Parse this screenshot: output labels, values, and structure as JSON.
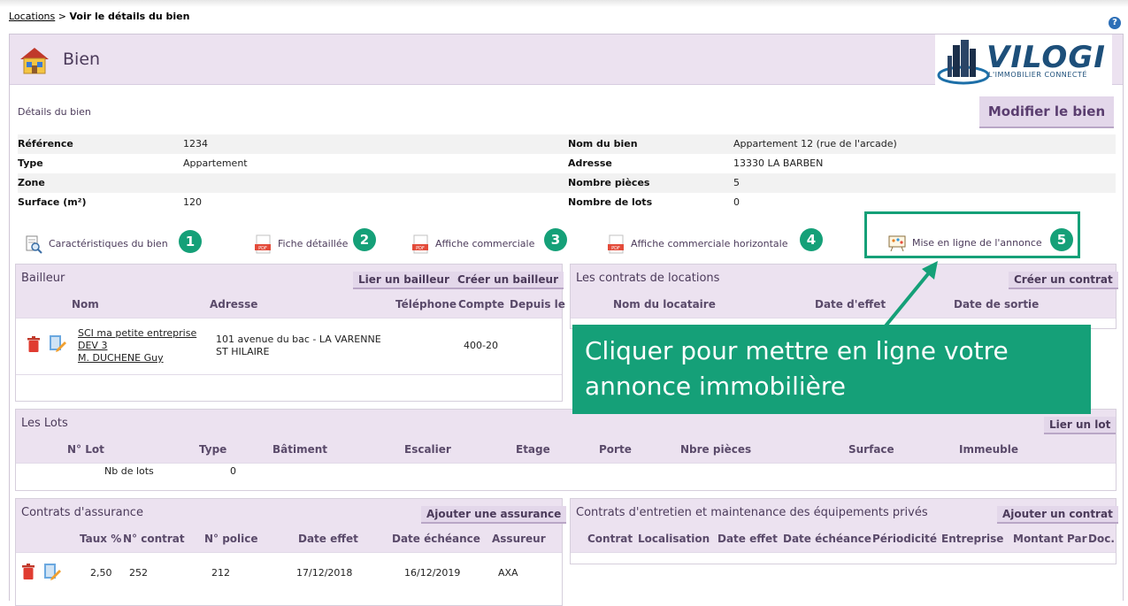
{
  "breadcrumb": {
    "link": "Locations",
    "separator": " > ",
    "current": "Voir le détails du bien"
  },
  "help": {
    "icon": "question-icon",
    "label": "?"
  },
  "header": {
    "title": "Bien"
  },
  "logo": {
    "word": "VILOGI",
    "tagline": "L'IMMOBILIER CONNECTÉ"
  },
  "section": {
    "subtitle": "Détails du bien",
    "modify_label": "Modifier le bien"
  },
  "details": {
    "left": [
      {
        "label": "Référence",
        "value": "1234"
      },
      {
        "label": "Type",
        "value": "Appartement"
      },
      {
        "label": "Zone",
        "value": ""
      },
      {
        "label": "Surface (m²)",
        "value": "120"
      }
    ],
    "right": [
      {
        "label": "Nom du bien",
        "value": "Appartement 12 (rue de l'arcade)"
      },
      {
        "label": "Adresse",
        "value": "13330 LA BARBEN"
      },
      {
        "label": "Nombre pièces",
        "value": "5"
      },
      {
        "label": "Nombre de lots",
        "value": "0"
      }
    ]
  },
  "actions": [
    {
      "label": "Caractéristiques du bien",
      "icon": "magnifier-document-icon",
      "number": "1"
    },
    {
      "label": "Fiche détaillée",
      "icon": "pdf-icon",
      "number": "2"
    },
    {
      "label": "Affiche commerciale",
      "icon": "pdf-icon",
      "number": "3"
    },
    {
      "label": "Affiche commerciale horizontale",
      "icon": "pdf-icon",
      "number": "4"
    },
    {
      "label": "Mise en ligne de l'annonce",
      "icon": "board-icon",
      "number": "5"
    }
  ],
  "bailleur": {
    "title": "Bailleur",
    "btn_link": "Lier un bailleur",
    "btn_create": "Créer un bailleur",
    "columns": [
      "Nom",
      "Adresse",
      "Téléphone",
      "Compte",
      "Depuis le"
    ],
    "row": {
      "name_lines": [
        "SCI ma petite entreprise",
        "DEV 3",
        "M. DUCHENE Guy"
      ],
      "address_lines": [
        "101 avenue du bac - LA VARENNE",
        "ST HILAIRE"
      ],
      "phone": "",
      "account": "400-20",
      "since": ""
    }
  },
  "contrats_locations": {
    "title": "Les contrats de locations",
    "btn_create": "Créer un contrat",
    "columns": [
      "Nom du locataire",
      "Date d'effet",
      "Date de sortie"
    ]
  },
  "callout": {
    "text": "Cliquer pour mettre en ligne votre annonce immobilière"
  },
  "lots": {
    "title": "Les Lots",
    "btn_link": "Lier un lot",
    "columns": [
      "N° Lot",
      "Type",
      "Bâtiment",
      "Escalier",
      "Etage",
      "Porte",
      "Nbre pièces",
      "Surface",
      "Immeuble"
    ],
    "summary_label": "Nb de lots",
    "summary_value": "0"
  },
  "assurance": {
    "title": "Contrats d'assurance",
    "btn_add": "Ajouter une assurance",
    "columns": [
      "Taux %",
      "N° contrat",
      "N° police",
      "Date effet",
      "Date échéance",
      "Assureur"
    ],
    "row": {
      "taux": "2,50",
      "contrat": "252",
      "police": "212",
      "date_effet": "17/12/2018",
      "date_echeance": "16/12/2019",
      "assureur": "AXA"
    }
  },
  "entretien": {
    "title": "Contrats d'entretien et maintenance des équipements privés",
    "btn_add": "Ajouter un contrat",
    "columns": [
      "Contrat",
      "Localisation",
      "Date effet",
      "Date échéance",
      "Périodicité",
      "Entreprise",
      "Montant Par",
      "Doc."
    ]
  },
  "colors": {
    "accent": "#15a078",
    "header_bg": "#ece2f0",
    "title_text": "#4b3a5a"
  }
}
